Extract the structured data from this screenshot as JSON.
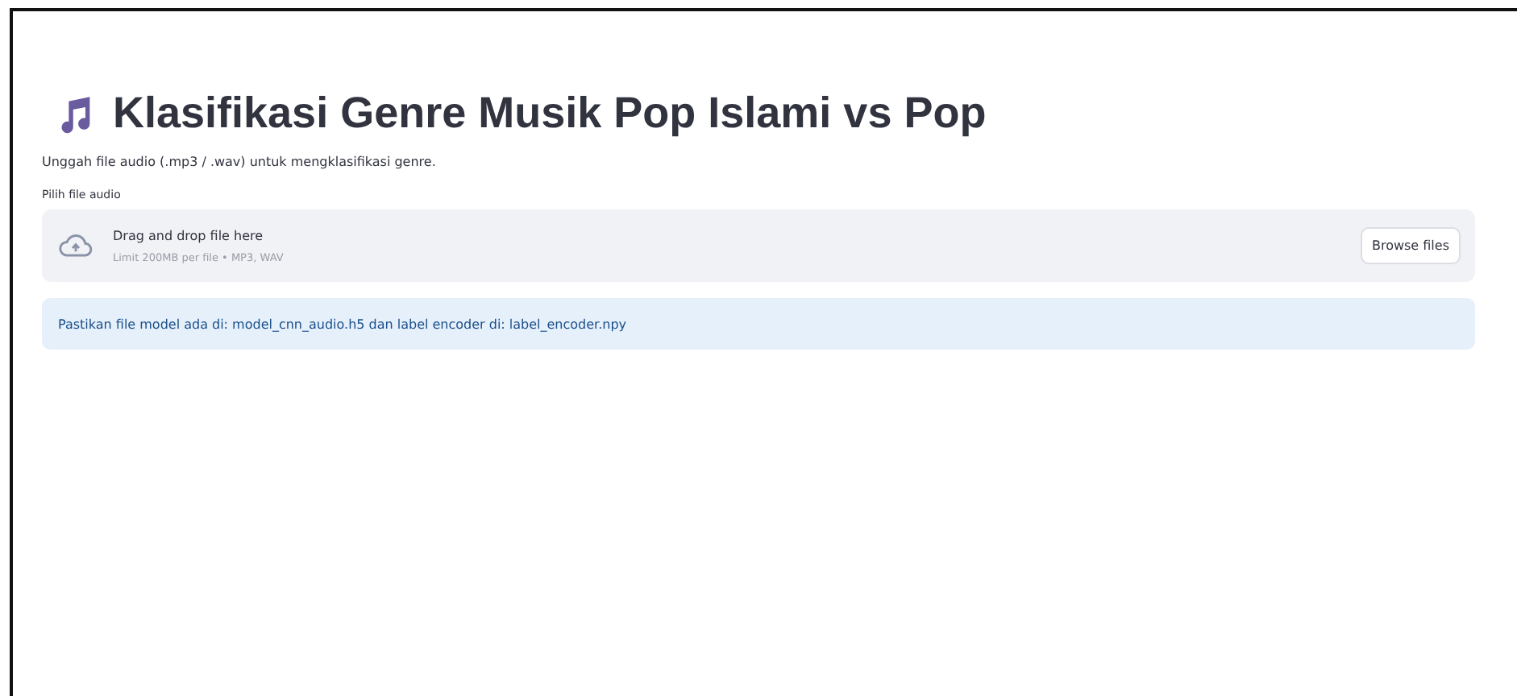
{
  "title": "Klasifikasi Genre Musik Pop Islami vs Pop",
  "subtitle": "Unggah file audio (.mp3 / .wav) untuk mengklasifikasi genre.",
  "uploader": {
    "label": "Pilih file audio",
    "dropzone_text": "Drag and drop file here",
    "limit_text": "Limit 200MB per file • MP3, WAV",
    "button": "Browse files"
  },
  "info": "Pastikan file model ada di: model_cnn_audio.h5 dan label encoder di: label_encoder.npy"
}
